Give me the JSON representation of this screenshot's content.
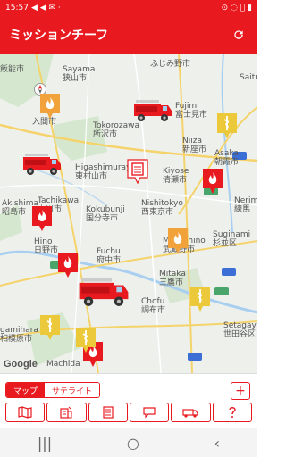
{
  "status": {
    "time": "15:57",
    "left_icons": "◀ ◀ ✉ ·",
    "right_icons": "⊙ ◌ ⃠ ▮"
  },
  "app": {
    "title": "ミッションチーフ",
    "refresh_icon": "refresh-icon"
  },
  "map": {
    "labels": [
      {
        "text": "Sayama\n狭山市",
        "cls": ""
      },
      {
        "text": "ふじみ野市",
        "cls": ""
      },
      {
        "text": "Fujimi\n富士見市",
        "cls": ""
      },
      {
        "text": "Tokorozawa\n所沢市",
        "cls": ""
      },
      {
        "text": "Niiza\n新座市",
        "cls": ""
      },
      {
        "text": "Asaka\n朝霞市",
        "cls": ""
      },
      {
        "text": "Higashimurayama\n東村山市",
        "cls": ""
      },
      {
        "text": "Kiyose\n清瀬市",
        "cls": ""
      },
      {
        "text": "Akishima\n昭島市",
        "cls": ""
      },
      {
        "text": "Tachikawa\n立川市",
        "cls": ""
      },
      {
        "text": "Kokubunji\n国分寺市",
        "cls": ""
      },
      {
        "text": "Nishitokyo\n西東京市",
        "cls": ""
      },
      {
        "text": "Nerim\n練馬",
        "cls": ""
      },
      {
        "text": "Hino\n日野市",
        "cls": ""
      },
      {
        "text": "Fuchu\n府中市",
        "cls": ""
      },
      {
        "text": "Suginami\n杉並区",
        "cls": ""
      },
      {
        "text": "Musashino\n武蔵野市",
        "cls": ""
      },
      {
        "text": "Mitaka\n三鷹市",
        "cls": ""
      },
      {
        "text": "Chofu\n調布市",
        "cls": ""
      },
      {
        "text": "Setagay\n世田谷区",
        "cls": ""
      },
      {
        "text": "gamihara\n相模原市",
        "cls": ""
      },
      {
        "text": "Machida",
        "cls": ""
      },
      {
        "text": "飯能市",
        "cls": ""
      },
      {
        "text": "入間市",
        "cls": ""
      },
      {
        "text": "Saitu",
        "cls": ""
      }
    ],
    "google_logo": "Google"
  },
  "controls": {
    "map_tab": "マップ",
    "satellite_tab": "サテライト",
    "zoom_plus": "+"
  },
  "toolbar": {
    "items": [
      "map-icon",
      "building-icon",
      "list-icon",
      "chat-icon",
      "vehicle-icon",
      "help-icon"
    ]
  },
  "nav": {
    "menu_icon": "|||",
    "home_icon": "○",
    "back_icon": "‹"
  }
}
